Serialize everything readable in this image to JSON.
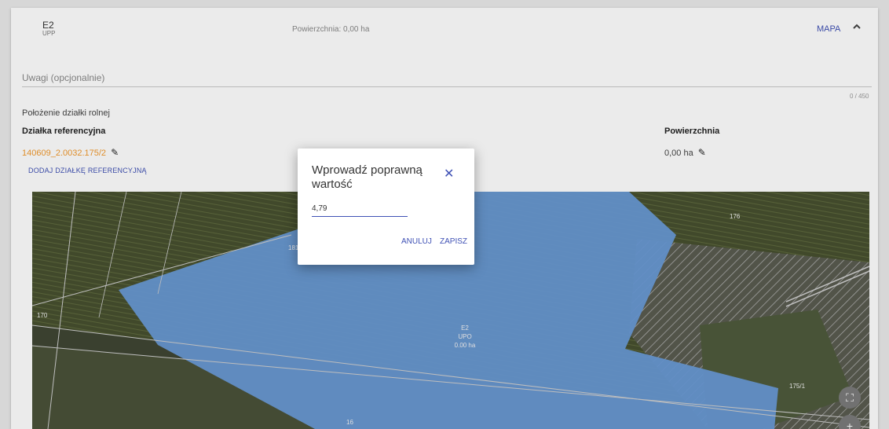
{
  "header": {
    "parcel_code": "E2",
    "parcel_sub": "UPP",
    "area_label": "Powierzchnia: 0,00 ha",
    "map_toggle": "MAPA",
    "chevron_icon": "chevron-up-icon"
  },
  "notes": {
    "placeholder": "Uwagi (opcjonalnie)",
    "value": "",
    "counter": "0 / 450"
  },
  "location": {
    "section_title": "Położenie działki rolnej",
    "col_reference": "Działka referencyjna",
    "col_area": "Powierzchnia",
    "reference_value": "140609_2.0032.175/2",
    "area_value": "0,00 ha",
    "add_reference": "DODAJ DZIAŁKĘ REFERENCYJNĄ",
    "edit_icon": "pencil-icon"
  },
  "map": {
    "labels": [
      "176",
      "181",
      "170",
      "175/1",
      "16"
    ],
    "parcel_label": [
      "E2",
      "UPO",
      "0.00 ha"
    ],
    "fill_color": "#6a9bd8",
    "controls": [
      "fullscreen-icon",
      "zoom-in-icon"
    ]
  },
  "dialog": {
    "title": "Wprowadź poprawną wartość",
    "input_value": "4,79",
    "cancel": "ANULUJ",
    "save": "ZAPISZ",
    "close_icon": "close-icon"
  },
  "colors": {
    "accent": "#3f51b5",
    "reference_link": "#f29a2e"
  }
}
